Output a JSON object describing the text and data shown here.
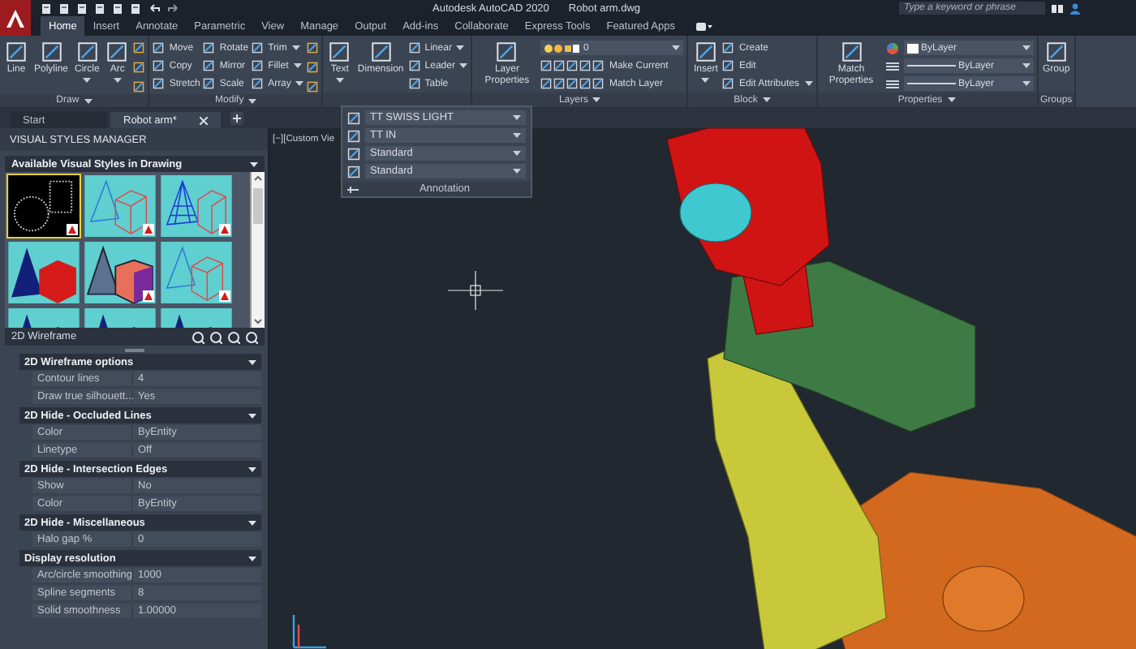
{
  "header": {
    "title": "Autodesk AutoCAD 2020",
    "file": "Robot arm.dwg",
    "search": {
      "placeholder": "Type a keyword or phrase"
    }
  },
  "ribbon_tabs": [
    {
      "label": "Home",
      "selected": true
    },
    {
      "label": "Insert",
      "selected": false
    },
    {
      "label": "Annotate",
      "selected": false
    },
    {
      "label": "Parametric",
      "selected": false
    },
    {
      "label": "View",
      "selected": false
    },
    {
      "label": "Manage",
      "selected": false
    },
    {
      "label": "Output",
      "selected": false
    },
    {
      "label": "Add-ins",
      "selected": false
    },
    {
      "label": "Collaborate",
      "selected": false
    },
    {
      "label": "Express Tools",
      "selected": false
    },
    {
      "label": "Featured Apps",
      "selected": false
    }
  ],
  "ribbon_panels": [
    {
      "title": "Draw",
      "dropdown": true,
      "columns": [
        {
          "kind": "large",
          "label": "Line",
          "dropdown": false
        },
        {
          "kind": "large",
          "label": "Polyline",
          "dropdown": false
        },
        {
          "kind": "large",
          "label": "Circle",
          "dropdown": true
        },
        {
          "kind": "large",
          "label": "Arc",
          "dropdown": true
        },
        {
          "kind": "icons"
        }
      ]
    },
    {
      "title": "Modify",
      "dropdown": true,
      "columns": [
        {
          "kind": "stack",
          "items": [
            {
              "label": "Move",
              "dropdown": false
            },
            {
              "label": "Copy",
              "dropdown": false
            },
            {
              "label": "Stretch",
              "dropdown": false
            }
          ]
        },
        {
          "kind": "stack",
          "items": [
            {
              "label": "Rotate",
              "dropdown": false
            },
            {
              "label": "Mirror",
              "dropdown": false
            },
            {
              "label": "Scale",
              "dropdown": false
            }
          ]
        },
        {
          "kind": "stack",
          "items": [
            {
              "label": "Trim",
              "dropdown": true
            },
            {
              "label": "Fillet",
              "dropdown": true
            },
            {
              "label": "Array",
              "dropdown": true
            }
          ]
        },
        {
          "kind": "icons"
        }
      ]
    },
    {
      "columns": [
        {
          "kind": "large",
          "label": "Text",
          "dropdown": true
        },
        {
          "kind": "large",
          "label": "Dimension",
          "dropdown": false
        },
        {
          "kind": "stack",
          "items": [
            {
              "label": "Linear",
              "dropdown": true
            },
            {
              "label": "Leader",
              "dropdown": true
            },
            {
              "label": "Table",
              "dropdown": false
            }
          ]
        }
      ]
    },
    {
      "title": "Layers",
      "dropdown": true,
      "columns": [
        {
          "kind": "large",
          "label": "Layer Properties",
          "dropdown": false
        },
        {
          "kind": "layers",
          "value": "0",
          "items": [
            {
              "label": "Make Current",
              "dropdown": false
            },
            {
              "label": "Match Layer",
              "dropdown": false
            }
          ]
        }
      ]
    },
    {
      "title": "Block",
      "dropdown": true,
      "columns": [
        {
          "kind": "large",
          "label": "Insert",
          "dropdown": true
        },
        {
          "kind": "stack",
          "items": [
            {
              "label": "Create",
              "dropdown": false
            },
            {
              "label": "Edit",
              "dropdown": false
            },
            {
              "label": "Edit Attributes",
              "dropdown": true
            }
          ]
        }
      ]
    },
    {
      "title": "Properties",
      "dropdown": true,
      "columns": [
        {
          "kind": "large",
          "label": "Match Properties",
          "dropdown": false
        },
        {
          "kind": "selects",
          "values": [
            "ByLayer",
            "ByLayer",
            "ByLayer"
          ]
        }
      ]
    },
    {
      "title": "Groups",
      "dropdown": false,
      "columns": [
        {
          "kind": "large",
          "label": "Group",
          "dropdown": false
        }
      ]
    }
  ],
  "annotation_flyout": {
    "fields": [
      "TT SWISS LIGHT",
      "TT IN",
      "Standard",
      "Standard"
    ],
    "title": "Annotation"
  },
  "doc_tabs": [
    {
      "label": "Start",
      "selected": false,
      "closable": false
    },
    {
      "label": "Robot arm*",
      "selected": true,
      "closable": true
    }
  ],
  "palette": {
    "title": "VISUAL STYLES MANAGER",
    "gallery": {
      "title": "Available Visual Styles in Drawing",
      "styles": [
        {
          "kind": "dark",
          "selected": true,
          "badge": true
        },
        {
          "kind": "lines",
          "selected": false,
          "badge": true
        },
        {
          "kind": "mesh",
          "selected": false,
          "badge": true
        },
        {
          "kind": "solid",
          "selected": false,
          "badge": false
        },
        {
          "kind": "solid-edges",
          "selected": false,
          "badge": true
        },
        {
          "kind": "lines",
          "selected": false,
          "badge": true
        },
        {
          "kind": "solid",
          "selected": false
        },
        {
          "kind": "solid",
          "selected": false
        },
        {
          "kind": "solid",
          "selected": false
        }
      ],
      "current": "2D Wireframe"
    },
    "sections": [
      {
        "title": "2D Wireframe options",
        "expanded": true,
        "rows": [
          {
            "label": "Contour lines",
            "value": "4"
          },
          {
            "label": "Draw true silhouett...",
            "value": "Yes"
          }
        ]
      },
      {
        "title": "2D Hide - Occluded Lines",
        "expanded": true,
        "rows": [
          {
            "label": "Color",
            "value": "ByEntity"
          },
          {
            "label": "Linetype",
            "value": "Off"
          }
        ]
      },
      {
        "title": "2D Hide - Intersection Edges",
        "expanded": true,
        "rows": [
          {
            "label": "Show",
            "value": "No"
          },
          {
            "label": "Color",
            "value": "ByEntity"
          }
        ]
      },
      {
        "title": "2D Hide - Miscellaneous",
        "expanded": true,
        "rows": [
          {
            "label": "Halo gap %",
            "value": "0"
          }
        ]
      },
      {
        "title": "Display resolution",
        "expanded": true,
        "rows": [
          {
            "label": "Arc/circle smoothing",
            "value": "1000"
          },
          {
            "label": "Spline segments",
            "value": "8"
          },
          {
            "label": "Solid smoothness",
            "value": "1.00000"
          }
        ]
      }
    ]
  },
  "viewport": {
    "label": "[−][Custom Vie"
  }
}
